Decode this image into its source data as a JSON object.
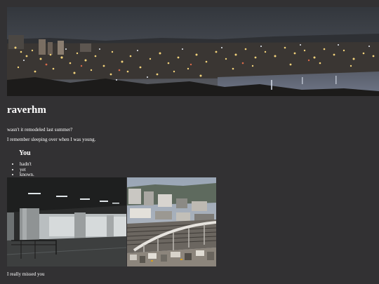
{
  "site": {
    "title": "raverhm",
    "line1": "wasn't it remodeled last summer?",
    "line2": "I remember sleeping over when I was young.",
    "subheading": "You",
    "list": [
      "hadn't",
      "yet",
      "known."
    ],
    "footer": "I really missed you"
  },
  "colors": {
    "page_background": "#323133",
    "text": "#ffffff"
  }
}
